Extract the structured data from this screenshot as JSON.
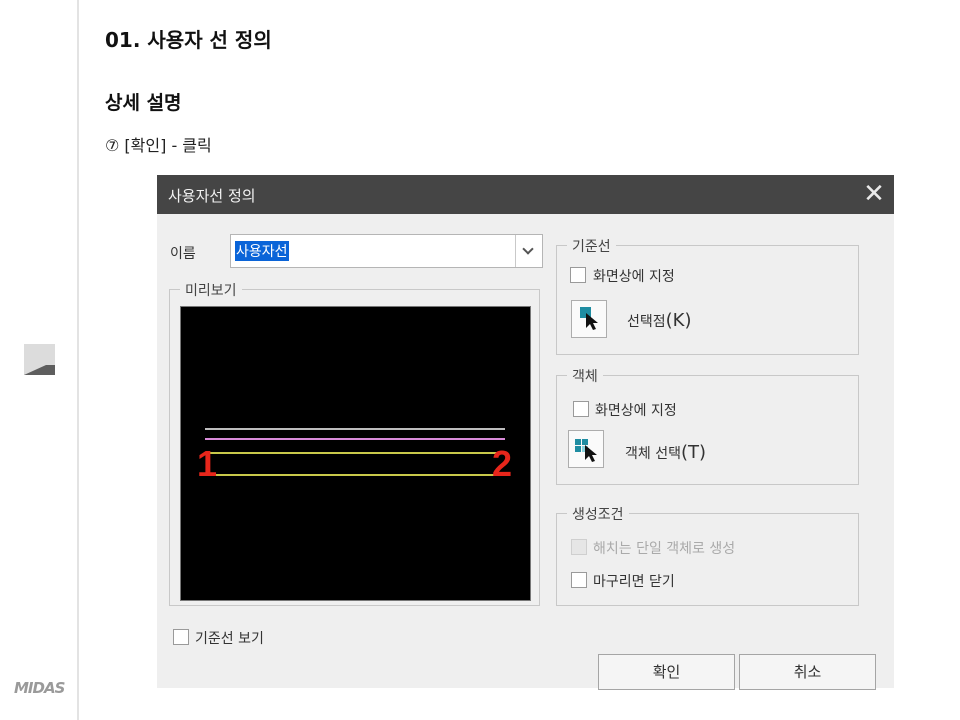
{
  "page": {
    "title": "01. 사용자 선 정의",
    "section": "상세 설명",
    "step": "⑦ [확인] - 클릭",
    "brand": "MIDAS"
  },
  "dialog": {
    "title": "사용자선 정의",
    "name_label": "이름",
    "name_value": "사용자선",
    "preview_label": "미리보기",
    "preview": {
      "start_label": "1",
      "end_label": "2",
      "line_colors": [
        "#bdbdbd",
        "#d98ad9",
        "#c8c84a",
        "#c8c84a"
      ]
    },
    "baseline_group": {
      "legend": "기준선",
      "screen_check": "화면상에 지정",
      "select_point_label": "선택점",
      "select_point_key": "(K)"
    },
    "object_group": {
      "legend": "객체",
      "screen_check": "화면상에 지정",
      "select_object_label": "객체 선택",
      "select_object_key": "(T)"
    },
    "create_group": {
      "legend": "생성조건",
      "merge_single": "해치는 단일 객체로 생성",
      "close_when_done": "마구리면 닫기"
    },
    "show_baseline": "기준선 보기",
    "ok": "확인",
    "cancel": "취소"
  }
}
